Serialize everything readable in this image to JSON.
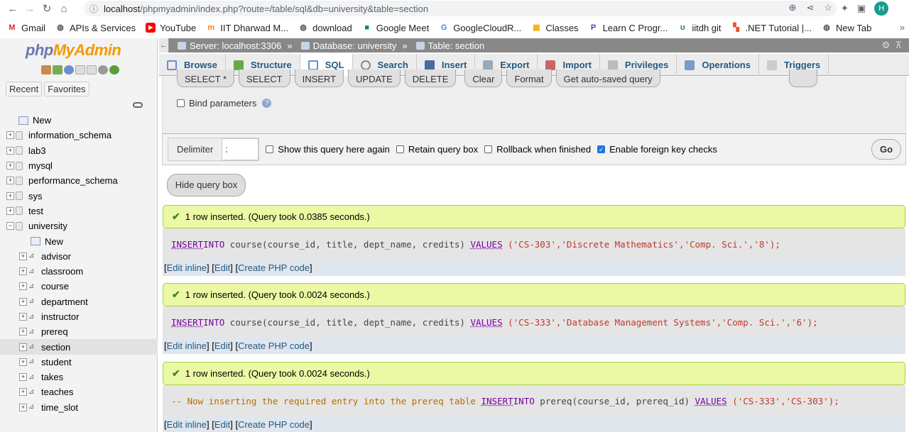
{
  "browser": {
    "url_host": "localhost",
    "url_path": "/phpmyadmin/index.php?route=/table/sql&db=university&table=section",
    "profile_initial": "H",
    "bookmarks": [
      "Gmail",
      "APIs & Services",
      "YouTube",
      "IIT Dharwad M...",
      "download",
      "Google Meet",
      "GoogleCloudR...",
      "Classes",
      "Learn C Progr...",
      "iitdh git",
      ".NET Tutorial |...",
      "New Tab"
    ],
    "bookmark_more": "»"
  },
  "nav": {
    "logo_php": "php",
    "logo_my": "MyAdmin",
    "recent": "Recent",
    "favorites": "Favorites",
    "new": "New",
    "databases": [
      "information_schema",
      "lab3",
      "mysql",
      "performance_schema",
      "sys",
      "test",
      "university"
    ],
    "university_new": "New",
    "tables": [
      "advisor",
      "classroom",
      "course",
      "department",
      "instructor",
      "prereq",
      "section",
      "student",
      "takes",
      "teaches",
      "time_slot"
    ]
  },
  "breadcrumb": {
    "server": "Server: localhost:3306",
    "database": "Database: university",
    "table": "Table: section",
    "sep": "»"
  },
  "menu": [
    "Browse",
    "Structure",
    "SQL",
    "Search",
    "Insert",
    "Export",
    "Import",
    "Privileges",
    "Operations",
    "Triggers"
  ],
  "query": {
    "buttons": [
      "SELECT *",
      "SELECT",
      "INSERT",
      "UPDATE",
      "DELETE",
      "Clear",
      "Format",
      "Get auto-saved query"
    ],
    "bind_parameters": "Bind parameters",
    "delimiter_label": "Delimiter",
    "delimiter_value": ";",
    "options": [
      "Show this query here again",
      "Retain query box",
      "Rollback when finished",
      "Enable foreign key checks"
    ],
    "go": "Go",
    "hide": "Hide query box"
  },
  "results": [
    {
      "message": "1 row inserted. (Query took 0.0385 seconds.)",
      "sql_prefix": "",
      "sql_kw1": "INSERT",
      "sql_kw2": "INTO",
      "sql_target": " course(course_id, title, dept_name, credits) ",
      "sql_kw3": "VALUES",
      "sql_values": " ('CS-303','Discrete Mathematics','Comp. Sci.','8');"
    },
    {
      "message": "1 row inserted. (Query took 0.0024 seconds.)",
      "sql_prefix": "",
      "sql_kw1": "INSERT",
      "sql_kw2": "INTO",
      "sql_target": " course(course_id, title, dept_name, credits) ",
      "sql_kw3": "VALUES",
      "sql_values": " ('CS-333','Database Management Systems','Comp. Sci.','6');"
    },
    {
      "message": "1 row inserted. (Query took 0.0024 seconds.)",
      "sql_prefix": "-- Now inserting the required entry into the prereq table ",
      "sql_kw1": "INSERT",
      "sql_kw2": "INTO",
      "sql_target": " prereq(course_id, prereq_id) ",
      "sql_kw3": "VALUES",
      "sql_values": " ('CS-333','CS-303');"
    }
  ],
  "actions": {
    "edit_inline": "Edit inline",
    "edit": "Edit",
    "create_php": "Create PHP code"
  }
}
